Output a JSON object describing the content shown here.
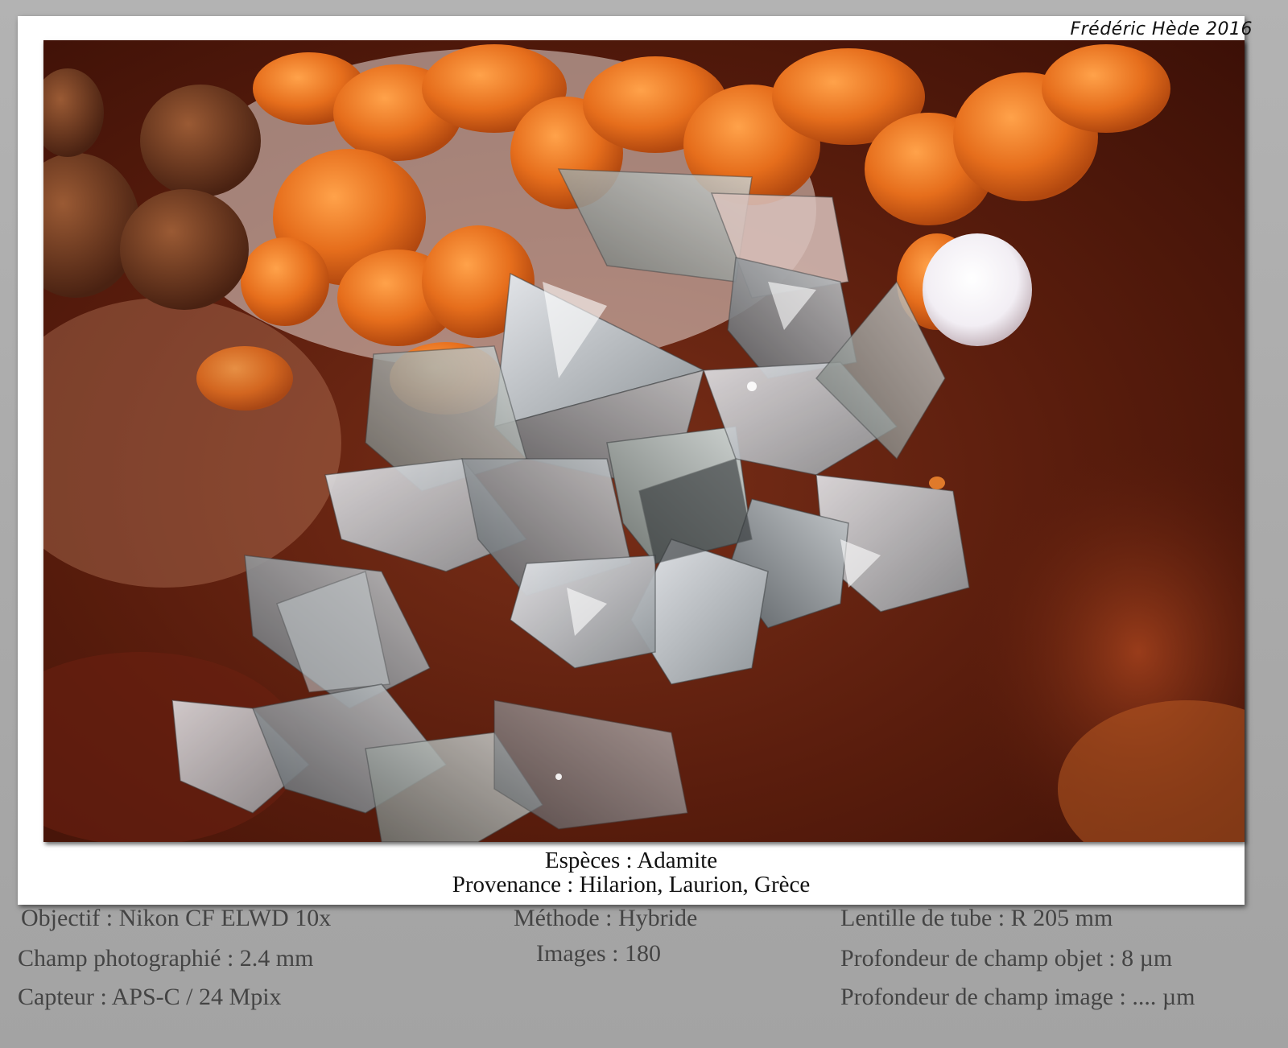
{
  "signature": "Frédéric Hède 2016",
  "caption": {
    "species": "Espèces : Adamite",
    "provenance": "Provenance : Hilarion, Laurion, Grèce"
  },
  "details": {
    "left": [
      "Objectif : Nikon CF ELWD 10x",
      "Champ photographié : 2.4 mm",
      "Capteur : APS-C / 24 Mpix"
    ],
    "center": [
      "Méthode : Hybride",
      "Images : 180"
    ],
    "right": [
      "Lentille de tube : R 205 mm",
      "Profondeur de champ objet : 8 µm",
      "Profondeur de champ image : .... µm"
    ]
  },
  "colors": {
    "frame_gray": "#a9a9a9",
    "card_white": "#ffffff",
    "crust_orange": "#e07a2a",
    "background_brown": "#4a140a",
    "crystal_gray": "#b9bfc3",
    "text_gray": "#444444"
  }
}
